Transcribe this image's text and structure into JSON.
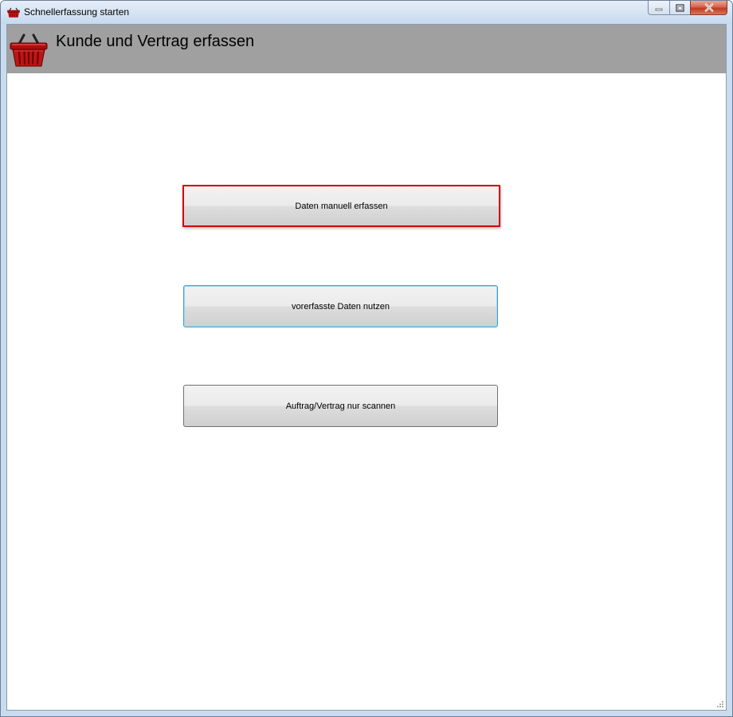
{
  "window": {
    "title": "Schnellerfassung starten",
    "icon": "basket-icon"
  },
  "header": {
    "title": "Kunde und Vertrag erfassen",
    "icon": "basket-icon",
    "background": "#a0a0a0"
  },
  "actions": [
    {
      "label": "Daten manuell erfassen",
      "state": "highlighted",
      "border_color": "#d10000"
    },
    {
      "label": "vorerfasste Daten nutzen",
      "state": "focused",
      "border_color": "#3c9fd5"
    },
    {
      "label": "Auftrag/Vertrag nur scannen",
      "state": "normal",
      "border_color": "#707070"
    }
  ]
}
